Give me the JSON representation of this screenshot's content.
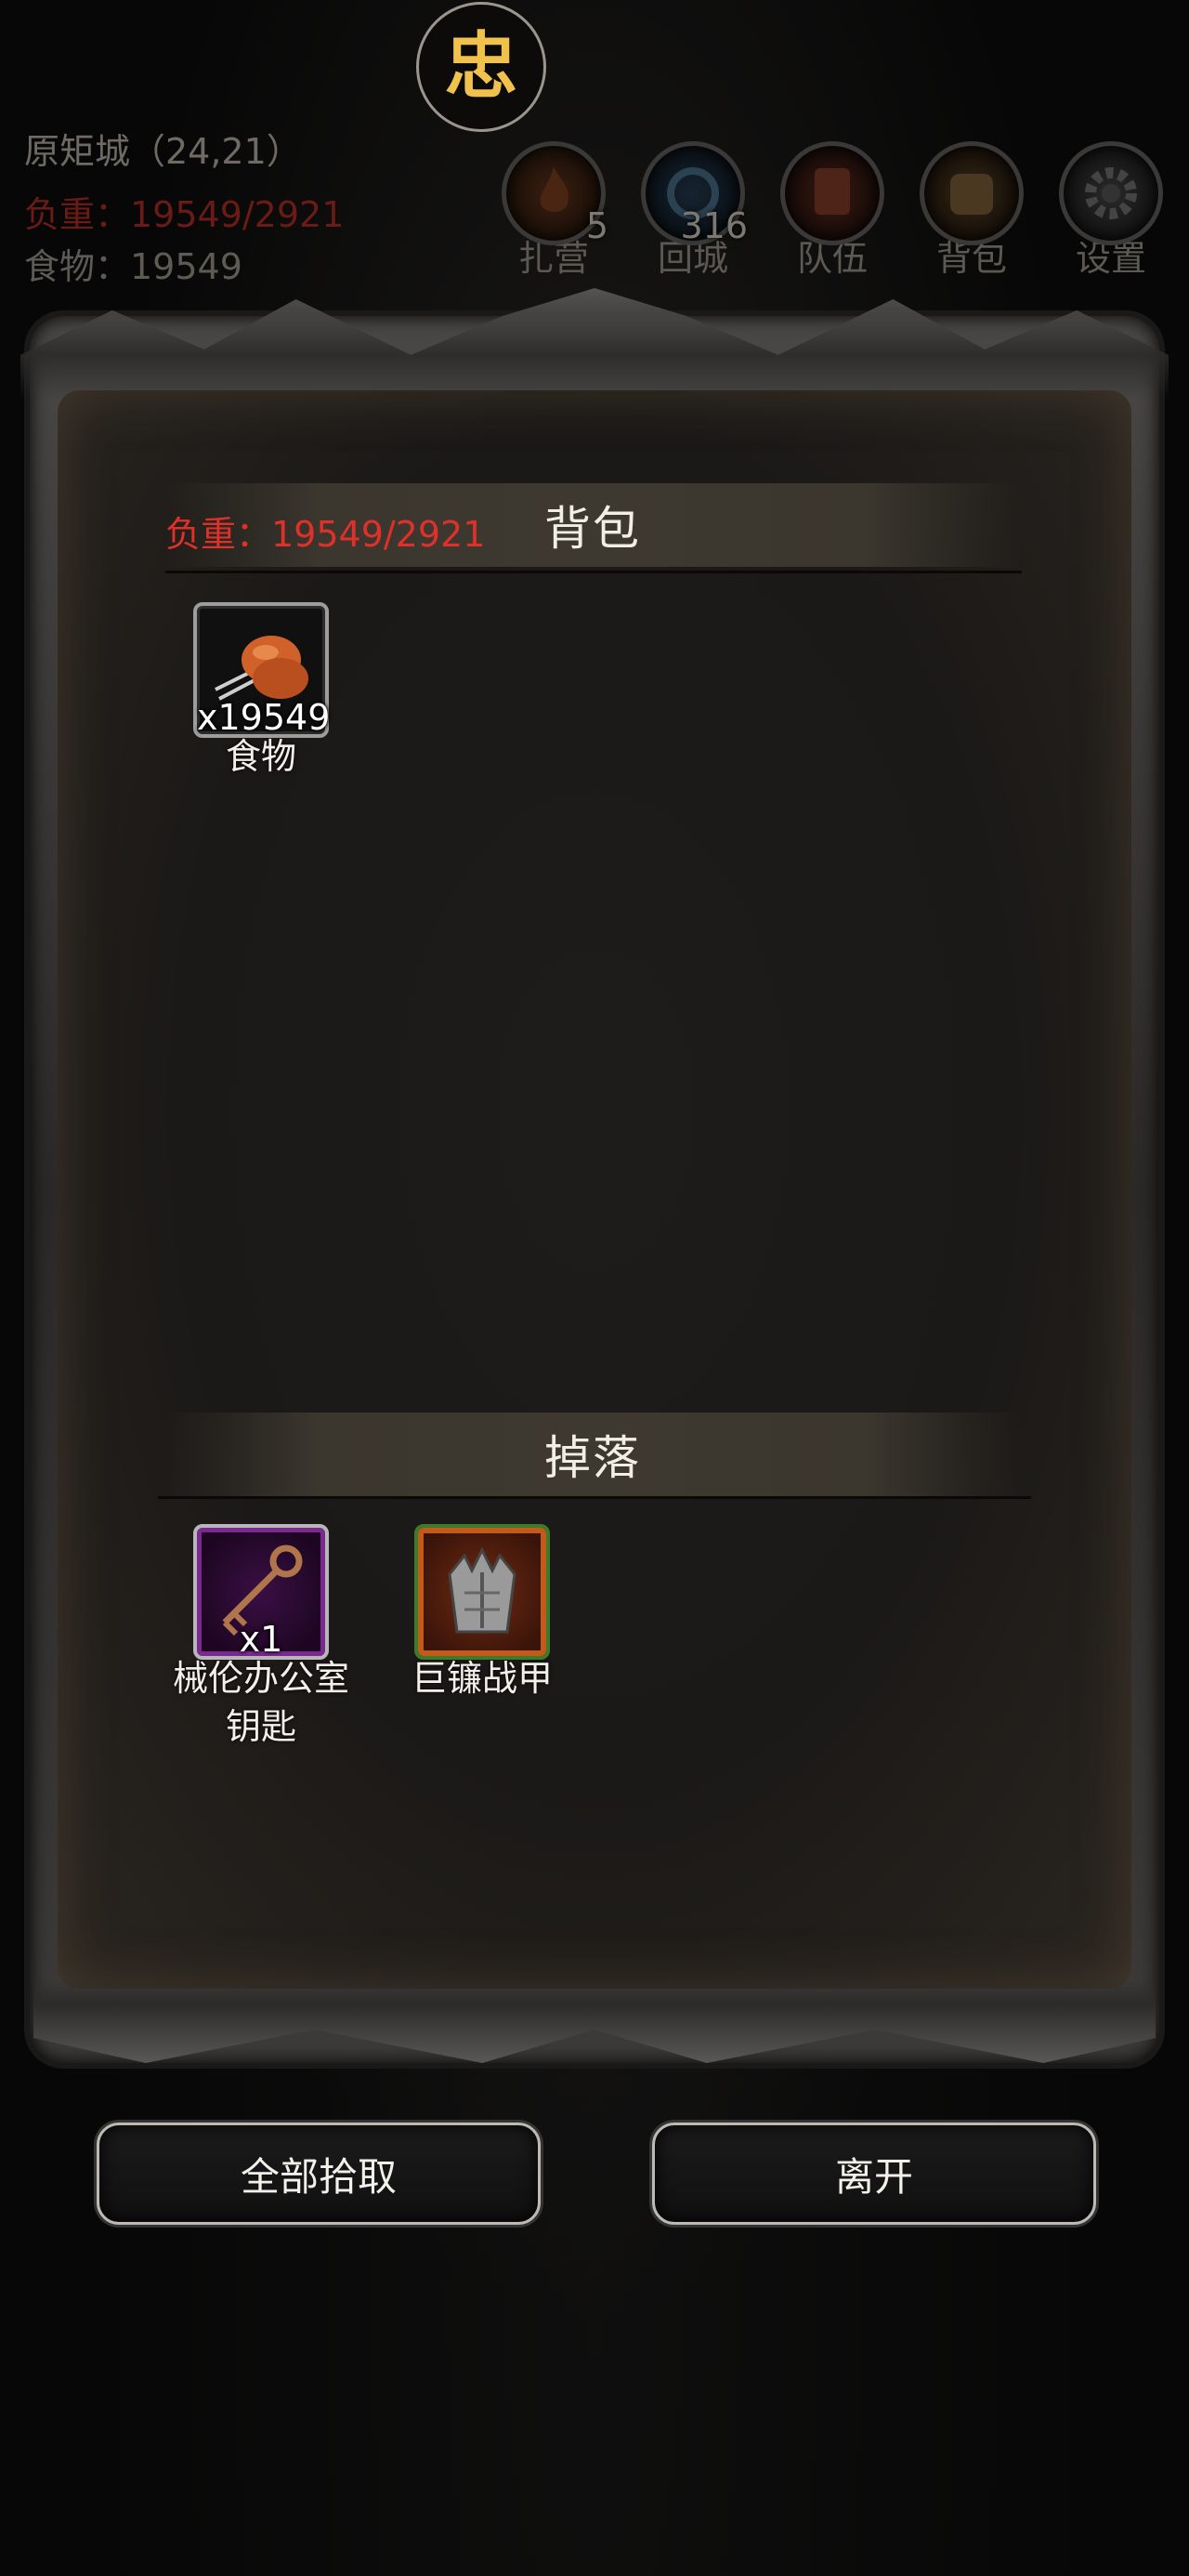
{
  "hud": {
    "center_glyph": "忠",
    "location": "原矩城（24,21）",
    "weight": "负重：19549/2921",
    "food": "食物：19549",
    "buttons": [
      {
        "icon": "campfire-icon",
        "label": "扎营",
        "count": "5"
      },
      {
        "icon": "portal-icon",
        "label": "回城",
        "count": "316"
      },
      {
        "icon": "team-banner-icon",
        "label": "队伍",
        "count": ""
      },
      {
        "icon": "backpack-icon",
        "label": "背包",
        "count": ""
      },
      {
        "icon": "gear-icon",
        "label": "设置",
        "count": ""
      }
    ]
  },
  "panel": {
    "bag": {
      "weight": "负重：19549/2921",
      "title": "背包",
      "items": [
        {
          "icon": "roast-meat-icon",
          "quantity": "x19549",
          "name": "食物"
        }
      ]
    },
    "drops": {
      "title": "掉落",
      "items": [
        {
          "icon": "key-icon",
          "quantity": "x1",
          "name_line1": "械伦办公室",
          "name_line2": "钥匙"
        },
        {
          "icon": "spiked-armor-icon",
          "quantity": "",
          "name_line1": "巨镰战甲",
          "name_line2": ""
        }
      ]
    }
  },
  "actions": {
    "pick_all": "全部拾取",
    "leave": "离开"
  },
  "colors": {
    "weight_red": "#e0302a",
    "center_glyph": "#f1c14e"
  }
}
